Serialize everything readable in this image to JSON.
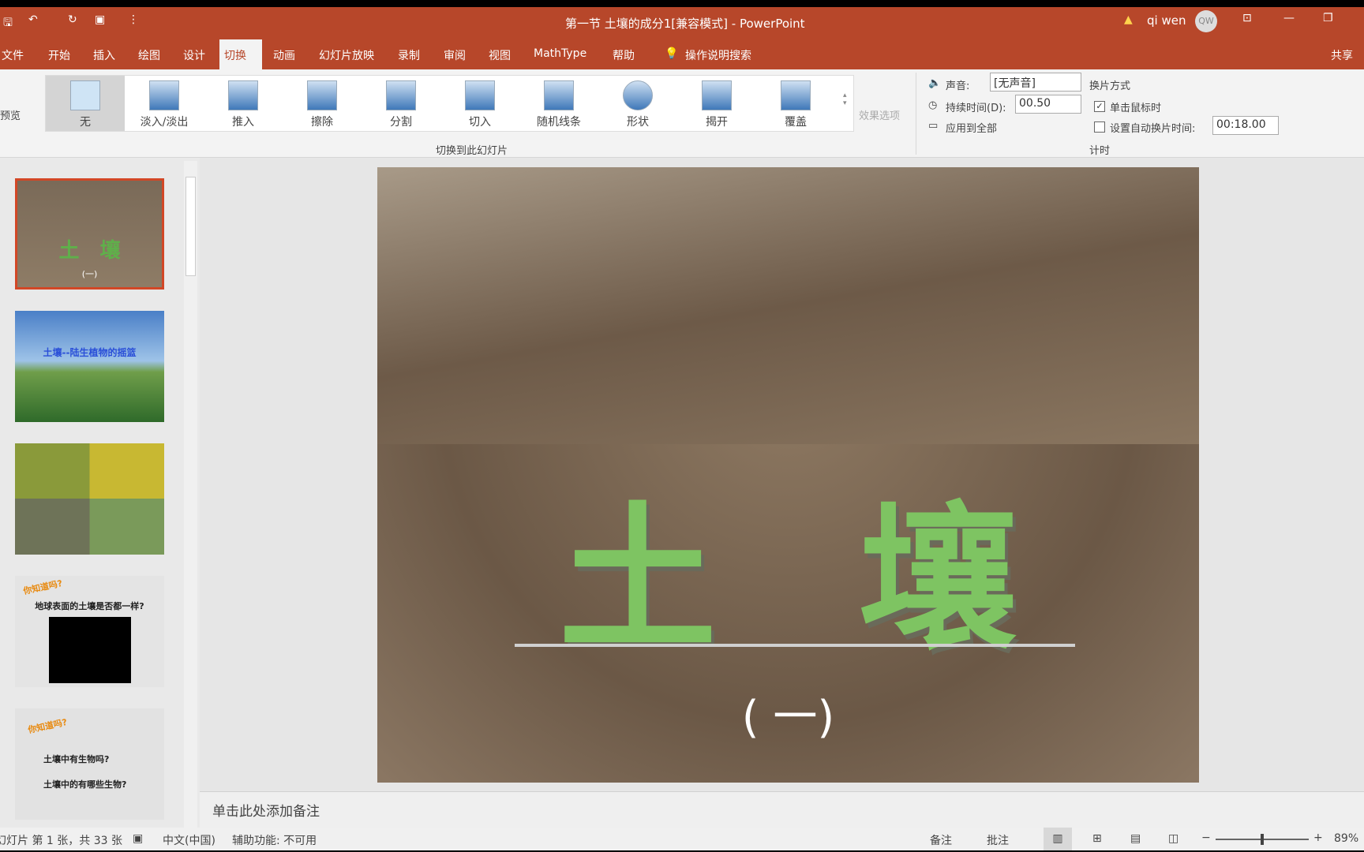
{
  "titlebar": {
    "title": "第一节 土壤的成分1[兼容模式] - PowerPoint",
    "user": "qi wen",
    "avatar": "QW",
    "warning_icon": "warning-icon"
  },
  "tabs": [
    "文件",
    "开始",
    "插入",
    "绘图",
    "设计",
    "切换",
    "动画",
    "幻灯片放映",
    "录制",
    "审阅",
    "视图",
    "MathType",
    "帮助"
  ],
  "active_tab": "切换",
  "search": "操作说明搜索",
  "share": "共享",
  "ribbon": {
    "preview": "预览",
    "transitions": [
      "无",
      "淡入/淡出",
      "推入",
      "擦除",
      "分割",
      "切入",
      "随机线条",
      "形状",
      "揭开",
      "覆盖"
    ],
    "effect_options": "效果选项",
    "group_transitions": "切换到此幻灯片",
    "sound_label": "声音:",
    "sound_value": "[无声音]",
    "duration_label": "持续时间(D):",
    "duration_value": "00.50",
    "apply_all": "应用到全部",
    "advance_label": "换片方式",
    "on_click": "单击鼠标时",
    "on_click_checked": true,
    "after_label": "设置自动换片时间:",
    "after_checked": false,
    "after_value": "00:18.00",
    "group_timing": "计时"
  },
  "thumbnails": [
    {
      "title": "土　壤",
      "sub": "(一)"
    },
    {
      "title": "土壤--陆生植物的摇篮"
    },
    {},
    {
      "badge": "你知道吗?",
      "text": "地球表面的土壤是否都一样?"
    },
    {
      "badge": "你知道吗?",
      "lines": [
        "土壤中有生物吗?",
        "土壤中的有哪些生物?"
      ]
    }
  ],
  "slide": {
    "char1": "土",
    "char2": "壤",
    "sub": "( 一)"
  },
  "notes_placeholder": "单击此处添加备注",
  "status": {
    "slide_info": "幻灯片 第 1 张，共 33 张",
    "language": "中文(中国)",
    "accessibility": "辅助功能: 不可用",
    "notes": "备注",
    "comments": "批注",
    "zoom": "89%",
    "zoom_fraction": 0.5
  }
}
